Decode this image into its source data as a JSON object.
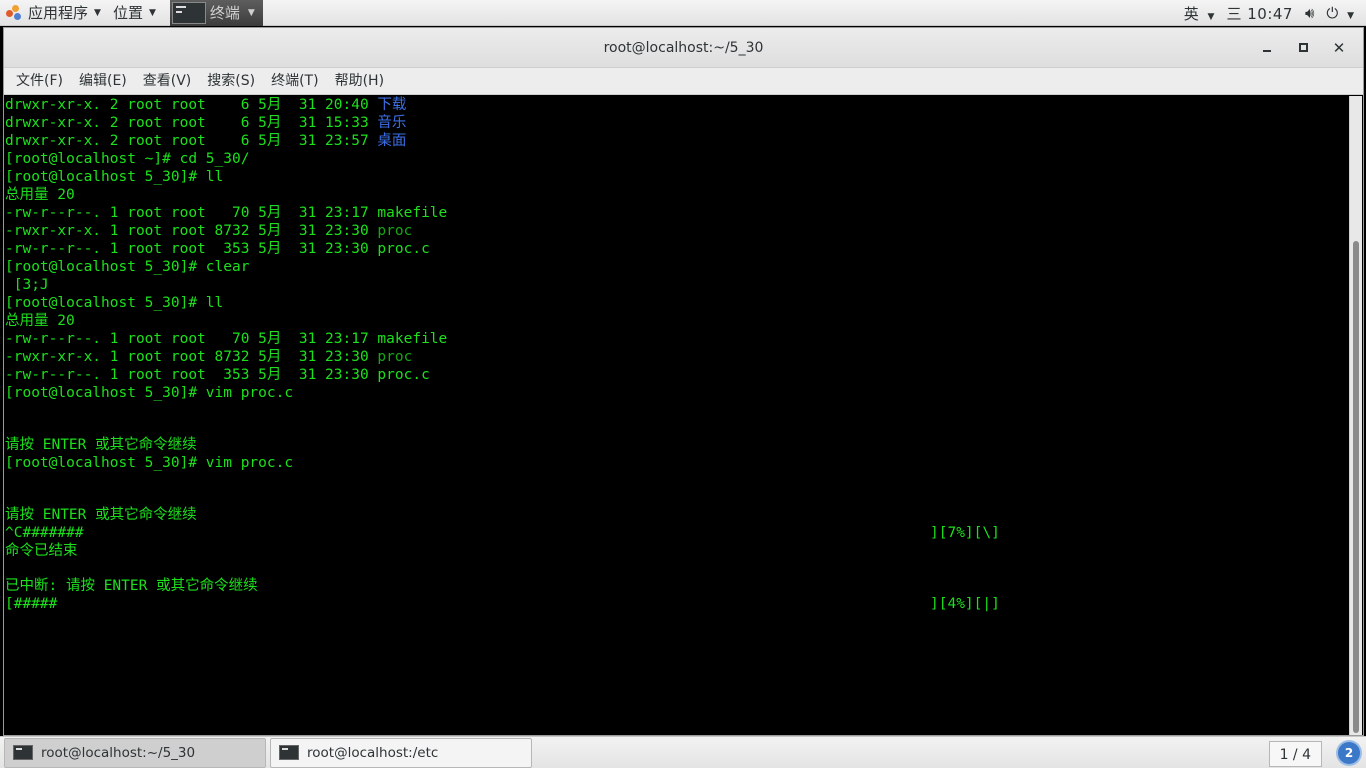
{
  "top_panel": {
    "applications_label": "应用程序",
    "places_label": "位置",
    "current_task_label": "终端",
    "input_method": "英",
    "clock": "三 10:47"
  },
  "window": {
    "title": "root@localhost:~/5_30",
    "menu": [
      "文件(F)",
      "编辑(E)",
      "查看(V)",
      "搜索(S)",
      "终端(T)",
      "帮助(H)"
    ]
  },
  "terminal": {
    "lines": [
      {
        "text": "drwxr-xr-x. 2 root root    6 5月  31 20:40 ",
        "tail": "下载",
        "tail_color": "blue"
      },
      {
        "text": "drwxr-xr-x. 2 root root    6 5月  31 15:33 ",
        "tail": "音乐",
        "tail_color": "blue"
      },
      {
        "text": "drwxr-xr-x. 2 root root    6 5月  31 23:57 ",
        "tail": "桌面",
        "tail_color": "blue"
      },
      {
        "text": "[root@localhost ~]# cd 5_30/"
      },
      {
        "text": "[root@localhost 5_30]# ll"
      },
      {
        "text": "总用量 20"
      },
      {
        "text": "-rw-r--r--. 1 root root   70 5月  31 23:17 makefile"
      },
      {
        "text": "-rwxr-xr-x. 1 root root 8732 5月  31 23:30 ",
        "tail": "proc",
        "tail_color": "dkgreen"
      },
      {
        "text": "-rw-r--r--. 1 root root  353 5月  31 23:30 proc.c"
      },
      {
        "text": "[root@localhost 5_30]# clear"
      },
      {
        "text": " [3;J"
      },
      {
        "text": "[root@localhost 5_30]# ll"
      },
      {
        "text": "总用量 20"
      },
      {
        "text": "-rw-r--r--. 1 root root   70 5月  31 23:17 makefile"
      },
      {
        "text": "-rwxr-xr-x. 1 root root 8732 5月  31 23:30 ",
        "tail": "proc",
        "tail_color": "dkgreen"
      },
      {
        "text": "-rw-r--r--. 1 root root  353 5月  31 23:30 proc.c"
      },
      {
        "text": "[root@localhost 5_30]# vim proc.c"
      },
      {
        "text": "",
        "gap": true
      },
      {
        "text": "",
        "gap": true
      },
      {
        "text": "请按 ENTER 或其它命令继续"
      },
      {
        "text": "[root@localhost 5_30]# vim proc.c"
      },
      {
        "text": "",
        "gap": true
      },
      {
        "text": "",
        "gap": true
      },
      {
        "text": "请按 ENTER 或其它命令继续"
      },
      {
        "text": "^C#######",
        "progress": "][7%][\\]"
      },
      {
        "text": "命令已结束"
      },
      {
        "text": "",
        "gap": true
      },
      {
        "text": "已中断: 请按 ENTER 或其它命令继续"
      },
      {
        "text": "[#####",
        "progress": "][4%][|]"
      }
    ]
  },
  "taskbar": {
    "tasks": [
      {
        "label": "root@localhost:~/5_30",
        "active": true
      },
      {
        "label": "root@localhost:/etc",
        "active": false
      }
    ],
    "workspace": "1 / 4",
    "badge": "2"
  }
}
